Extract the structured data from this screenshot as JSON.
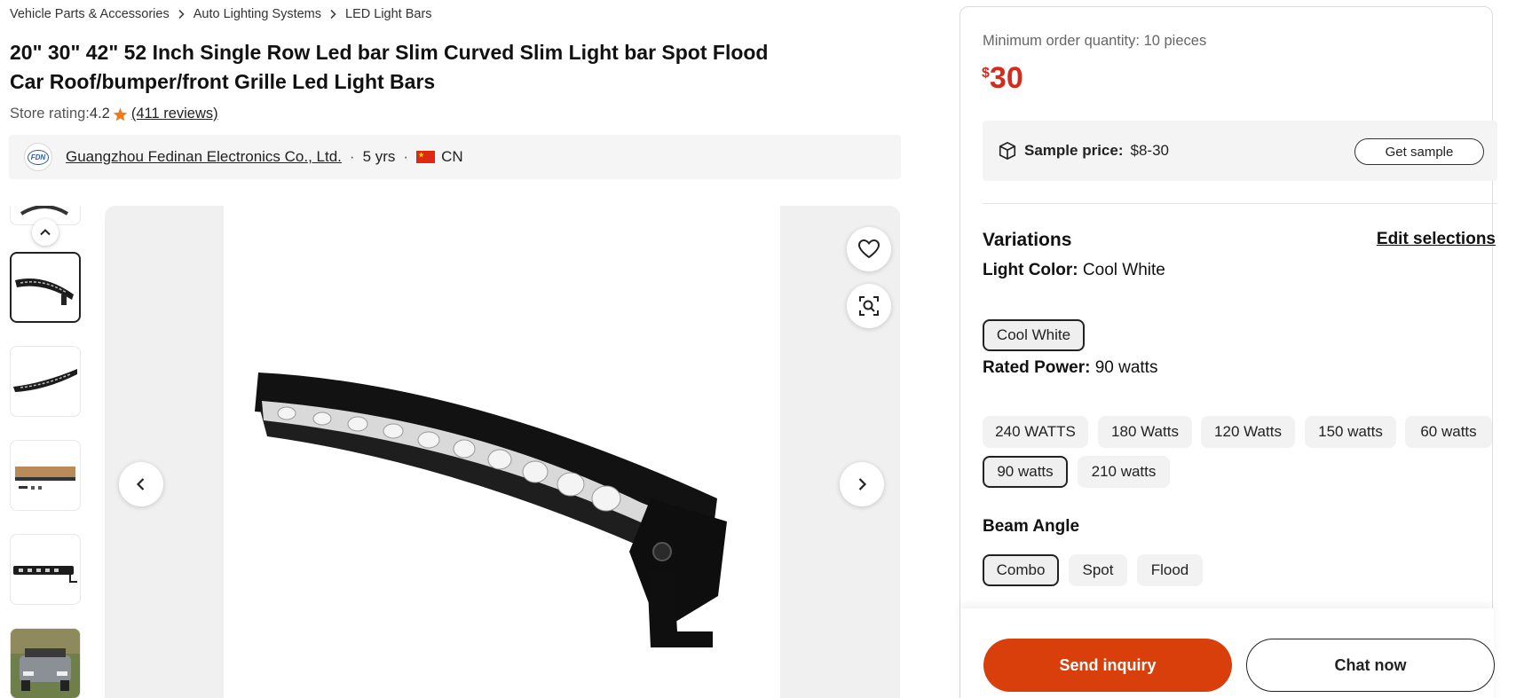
{
  "breadcrumb": {
    "items": [
      "Vehicle Parts & Accessories",
      "Auto Lighting Systems",
      "LED Light Bars"
    ]
  },
  "product": {
    "title": "20\" 30\" 42\" 52 Inch Single Row Led bar Slim Curved Slim Light bar Spot Flood Car Roof/bumper/front Grille Led Light Bars",
    "rating_label": "Store rating:",
    "rating_value": "4.2",
    "reviews": "(411 reviews)"
  },
  "supplier": {
    "logo_text": "FDN",
    "name": "Guangzhou Fedinan Electronics Co., Ltd.",
    "years": "5 yrs",
    "country": "CN",
    "separator": "·"
  },
  "gallery": {
    "icons": {
      "favorite": "heart-icon",
      "search_image": "image-search-icon",
      "prev": "chevron-left-icon",
      "next": "chevron-right-icon",
      "thumbs_up": "chevron-up-icon"
    }
  },
  "pricing": {
    "moq": "Minimum order quantity: 10 pieces",
    "currency": "$",
    "price": "30",
    "sample_label": "Sample price:",
    "sample_value": "$8-30",
    "get_sample": "Get sample"
  },
  "variations": {
    "title": "Variations",
    "edit": "Edit selections",
    "light_color": {
      "label": "Light Color:",
      "selected": "Cool White",
      "options": [
        "Cool White"
      ]
    },
    "rated_power": {
      "label": "Rated Power:",
      "selected": "90 watts",
      "options": [
        "240 WATTS",
        "180 Watts",
        "120 Watts",
        "150 watts",
        "60 watts",
        "90 watts",
        "210 watts"
      ]
    },
    "beam_angle": {
      "label": "Beam Angle",
      "options": [
        "Combo",
        "Spot",
        "Flood"
      ]
    }
  },
  "actions": {
    "inquiry": "Send inquiry",
    "chat": "Chat now"
  },
  "colors": {
    "accent": "#d93f0b",
    "price": "#d42b1e",
    "selected_border": "#222222"
  }
}
